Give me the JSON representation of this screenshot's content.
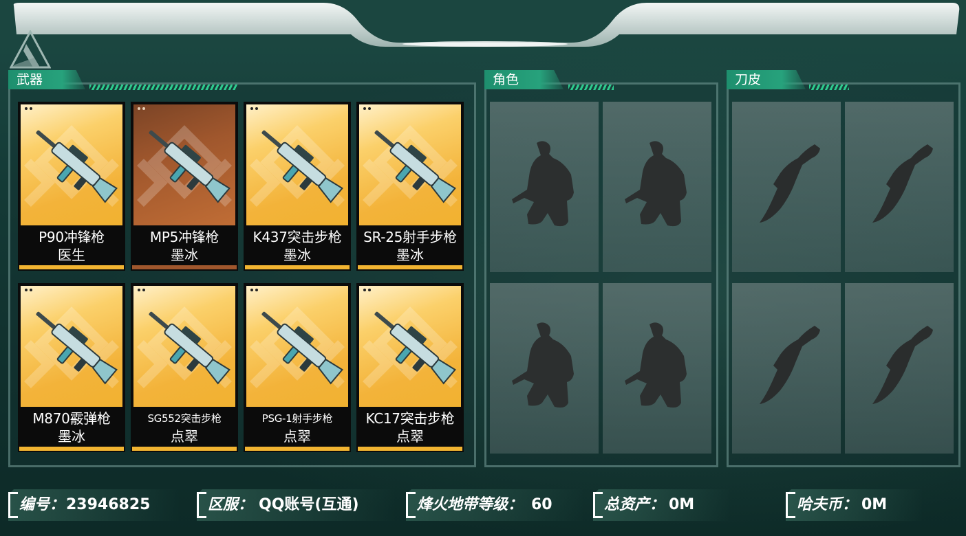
{
  "sections": {
    "weapons_title": "武器",
    "roles_title": "角色",
    "knife_title": "刀皮"
  },
  "weapons": [
    {
      "name": "P90冲锋枪",
      "skin": "医生",
      "bg": "gold"
    },
    {
      "name": "MP5冲锋枪",
      "skin": "墨冰",
      "bg": "bronze"
    },
    {
      "name": "K437突击步枪",
      "skin": "墨冰",
      "bg": "gold"
    },
    {
      "name": "SR-25射手步枪",
      "skin": "墨冰",
      "bg": "gold"
    },
    {
      "name": "M870霰弹枪",
      "skin": "墨冰",
      "bg": "gold"
    },
    {
      "name": "SG552突击步枪",
      "skin": "点翠",
      "bg": "gold"
    },
    {
      "name": "PSG-1射手步枪",
      "skin": "点翠",
      "bg": "gold"
    },
    {
      "name": "KC17突击步枪",
      "skin": "点翠",
      "bg": "gold"
    }
  ],
  "footer": {
    "id_label": "编号：",
    "id_value": "23946825",
    "server_label": "区服：",
    "server_value": "QQ账号(互通)",
    "level_label": "烽火地带等级：",
    "level_value": "60",
    "assets_label": "总资产：",
    "assets_value": "0M",
    "coin_label": "哈夫币：",
    "coin_value": "0M"
  },
  "colors": {
    "accent_green": "#27a27c",
    "card_gold": "#f2b431",
    "card_bronze": "#a0572d"
  },
  "icons": [
    "logo-icon",
    "rifle-icon",
    "soldier-silhouette-icon",
    "knife-silhouette-icon"
  ]
}
